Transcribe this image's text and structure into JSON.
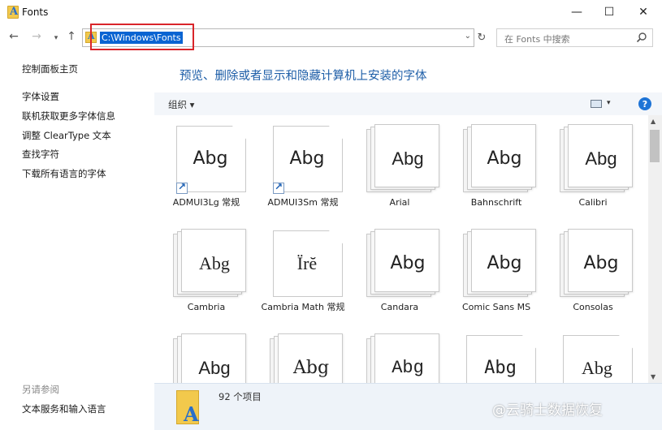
{
  "window": {
    "title": "Fonts",
    "min_glyph": "—",
    "max_glyph": "☐",
    "close_glyph": "✕"
  },
  "address": {
    "path": "C:\\Windows\\Fonts",
    "search_placeholder": "在 Fonts 中搜索"
  },
  "sidebar": {
    "home": "控制面板主页",
    "links": [
      "字体设置",
      "联机获取更多字体信息",
      "调整 ClearType 文本",
      "查找字符",
      "下载所有语言的字体"
    ],
    "see_also": "另请参阅",
    "text_services": "文本服务和输入语言"
  },
  "main": {
    "heading": "预览、删除或者显示和隐藏计算机上安装的字体",
    "organize": "组织 ▾",
    "help": "?"
  },
  "fonts": [
    {
      "name": "ADMUI3Lg 常规",
      "sample": "Abg",
      "stack": false,
      "shortcut": true,
      "family": "\"DejaVu Sans\", sans-serif"
    },
    {
      "name": "ADMUI3Sm 常规",
      "sample": "Abg",
      "stack": false,
      "shortcut": true,
      "family": "\"DejaVu Sans\", sans-serif"
    },
    {
      "name": "Arial",
      "sample": "Abg",
      "stack": true,
      "shortcut": false,
      "family": "\"Liberation Sans\", sans-serif"
    },
    {
      "name": "Bahnschrift",
      "sample": "Abg",
      "stack": true,
      "shortcut": false,
      "family": "\"DejaVu Sans\", sans-serif"
    },
    {
      "name": "Calibri",
      "sample": "Abg",
      "stack": true,
      "shortcut": false,
      "family": "\"Liberation Sans\", sans-serif"
    },
    {
      "name": "Cambria",
      "sample": "Abg",
      "stack": true,
      "shortcut": false,
      "family": "\"Liberation Serif\", serif"
    },
    {
      "name": "Cambria Math 常规",
      "sample": "Ïrĕ",
      "stack": false,
      "shortcut": false,
      "family": "\"Liberation Serif\", serif"
    },
    {
      "name": "Candara",
      "sample": "Abg",
      "stack": true,
      "shortcut": false,
      "family": "\"DejaVu Sans\", sans-serif"
    },
    {
      "name": "Comic Sans MS",
      "sample": "Abg",
      "stack": true,
      "shortcut": false,
      "family": "\"DejaVu Sans\", sans-serif"
    },
    {
      "name": "Consolas",
      "sample": "Abg",
      "stack": true,
      "shortcut": false,
      "family": "\"DejaVu Sans\", sans-serif"
    },
    {
      "name": "",
      "sample": "Abg",
      "stack": true,
      "shortcut": false,
      "family": "\"Liberation Sans\", sans-serif"
    },
    {
      "name": "",
      "sample": "Abg",
      "stack": true,
      "shortcut": false,
      "family": "\"DejaVu Serif\", serif"
    },
    {
      "name": "",
      "sample": "Abg",
      "stack": true,
      "shortcut": false,
      "family": "\"Liberation Mono\", monospace"
    },
    {
      "name": "",
      "sample": "Abg",
      "stack": false,
      "shortcut": false,
      "family": "\"DejaVu Sans Mono\", monospace"
    },
    {
      "name": "",
      "sample": "Abg",
      "stack": false,
      "shortcut": false,
      "family": "\"Liberation Serif\", serif"
    }
  ],
  "details": {
    "count": "92 个项目"
  },
  "watermark": "@云骑士数据恢复",
  "colors": {
    "accent": "#1f5fa8",
    "selection": "#0a64d2",
    "highlight_box": "#d9252a"
  }
}
